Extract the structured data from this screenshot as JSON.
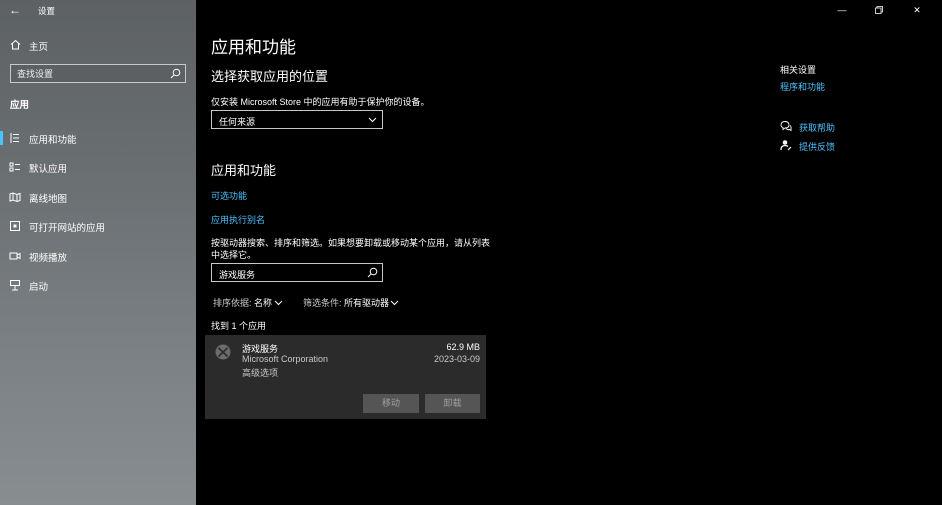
{
  "window": {
    "title": "设置",
    "back_icon": "back-arrow-icon",
    "controls": [
      "minimize",
      "restore",
      "close"
    ]
  },
  "sidebar": {
    "home_label": "主页",
    "search_placeholder": "查找设置",
    "section_label": "应用",
    "items": [
      {
        "label": "应用和功能",
        "icon": "apps-features-icon",
        "active": true
      },
      {
        "label": "默认应用",
        "icon": "default-apps-icon",
        "active": false
      },
      {
        "label": "离线地图",
        "icon": "offline-maps-icon",
        "active": false
      },
      {
        "label": "可打开网站的应用",
        "icon": "apps-for-websites-icon",
        "active": false
      },
      {
        "label": "视频播放",
        "icon": "video-playback-icon",
        "active": false
      },
      {
        "label": "启动",
        "icon": "startup-icon",
        "active": false
      }
    ]
  },
  "main": {
    "page_title": "应用和功能",
    "install_section": {
      "heading": "选择获取应用的位置",
      "description": "仅安装 Microsoft Store 中的应用有助于保护你的设备。",
      "dropdown_value": "任何来源"
    },
    "apps_section": {
      "heading": "应用和功能",
      "optional_features_link": "可选功能",
      "app_aliases_link": "应用执行别名",
      "instructions": "按驱动器搜索、排序和筛选。如果想要卸载或移动某个应用，请从列表中选择它。",
      "search_value": "游戏服务",
      "sort_label": "排序依据:",
      "sort_value": "名称",
      "filter_label": "筛选条件:",
      "filter_value": "所有驱动器",
      "found_text": "找到 1 个应用",
      "app": {
        "name": "游戏服务",
        "publisher": "Microsoft Corporation",
        "advanced": "高级选项",
        "size": "62.9 MB",
        "date": "2023-03-09",
        "move_button": "移动",
        "uninstall_button": "卸载"
      }
    }
  },
  "related": {
    "title": "相关设置",
    "link": "程序和功能",
    "help_items": [
      {
        "label": "获取帮助",
        "icon": "get-help-icon"
      },
      {
        "label": "提供反馈",
        "icon": "feedback-icon"
      }
    ]
  },
  "colors": {
    "accent": "#4cc2ff",
    "background": "#000000",
    "card": "#2b2b2b",
    "disabled_button": "#555555"
  }
}
